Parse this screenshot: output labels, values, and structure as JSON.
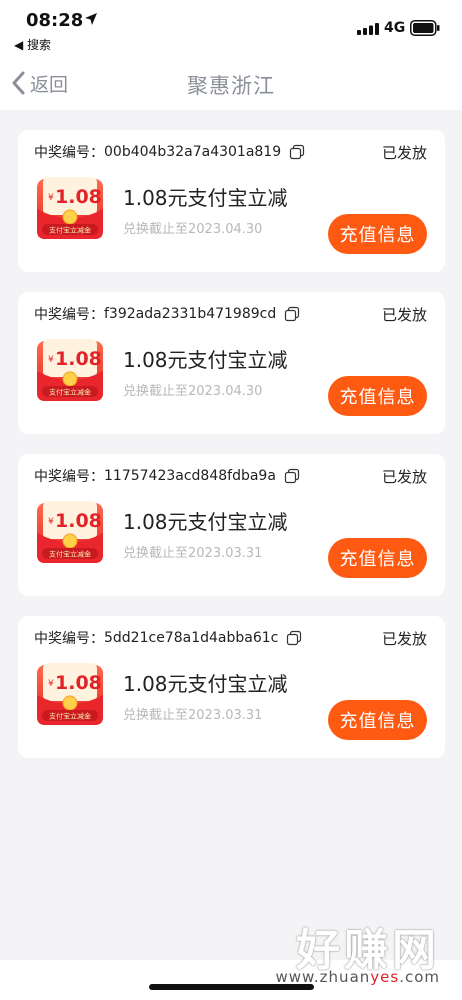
{
  "status_bar": {
    "time": "08:28",
    "back_app": "◀ 搜索",
    "network": "4G"
  },
  "nav": {
    "back_label": "返回",
    "title": "聚惠浙江"
  },
  "coupon_graphic": {
    "amount": "1.08",
    "currency_symbol": "¥",
    "caption": "支付宝立减金"
  },
  "cards": [
    {
      "id_label": "中奖编号：",
      "id_value": "00b404b32a7a4301a819",
      "status": "已发放",
      "prize_title": "1.08元支付宝立减",
      "deadline": "兑换截止至2023.04.30",
      "button_label": "充值信息"
    },
    {
      "id_label": "中奖编号：",
      "id_value": "f392ada2331b471989cd",
      "status": "已发放",
      "prize_title": "1.08元支付宝立减",
      "deadline": "兑换截止至2023.04.30",
      "button_label": "充值信息"
    },
    {
      "id_label": "中奖编号：",
      "id_value": "11757423acd848fdba9a",
      "status": "已发放",
      "prize_title": "1.08元支付宝立减",
      "deadline": "兑换截止至2023.03.31",
      "button_label": "充值信息"
    },
    {
      "id_label": "中奖编号：",
      "id_value": "5dd21ce78a1d4abba61c",
      "status": "已发放",
      "prize_title": "1.08元支付宝立减",
      "deadline": "兑换截止至2023.03.31",
      "button_label": "充值信息"
    }
  ],
  "watermark": {
    "brand": "好赚网",
    "url_prefix": "www.zhuan",
    "url_accent": "yes",
    "url_suffix": ".com"
  },
  "colors": {
    "accent": "#ff5a12",
    "nav_text": "#8a8f99",
    "background": "#f4f4f6"
  }
}
